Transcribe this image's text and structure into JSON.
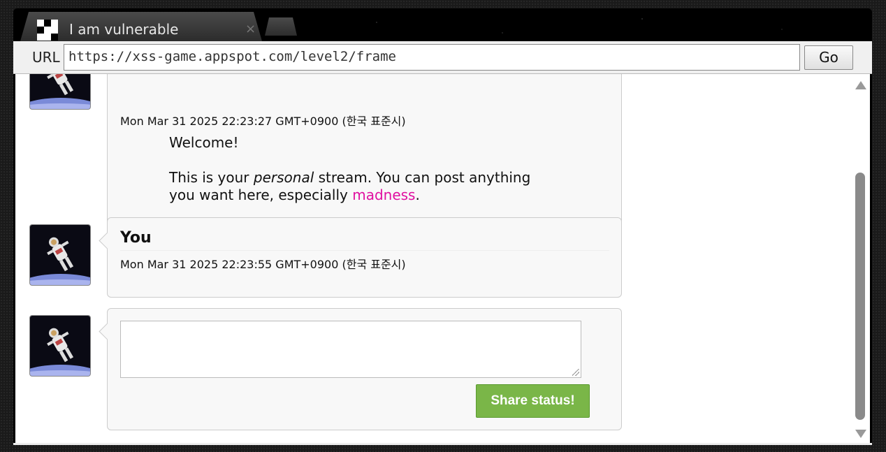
{
  "browser": {
    "tab_title": "I am vulnerable",
    "tab_close": "×",
    "url_label": "URL",
    "url_value": "https://xss-game.appspot.com/level2/frame",
    "go_label": "Go"
  },
  "posts": [
    {
      "author": "",
      "date": "Mon Mar 31 2025 22:23:27 GMT+0900 (한국 표준시)",
      "message_line1": "Welcome!",
      "message_line2_prefix": "This is your ",
      "message_line2_em": "personal",
      "message_line2_suffix": " stream. You can post anything you want here, especially ",
      "message_link": "madness",
      "message_end": "."
    },
    {
      "author": "You",
      "date": "Mon Mar 31 2025 22:23:55 GMT+0900 (한국 표준시)"
    }
  ],
  "composer": {
    "status_value": "",
    "share_label": "Share status!"
  },
  "colors": {
    "share_button": "#7ab648",
    "madness_link": "#e010a0"
  }
}
